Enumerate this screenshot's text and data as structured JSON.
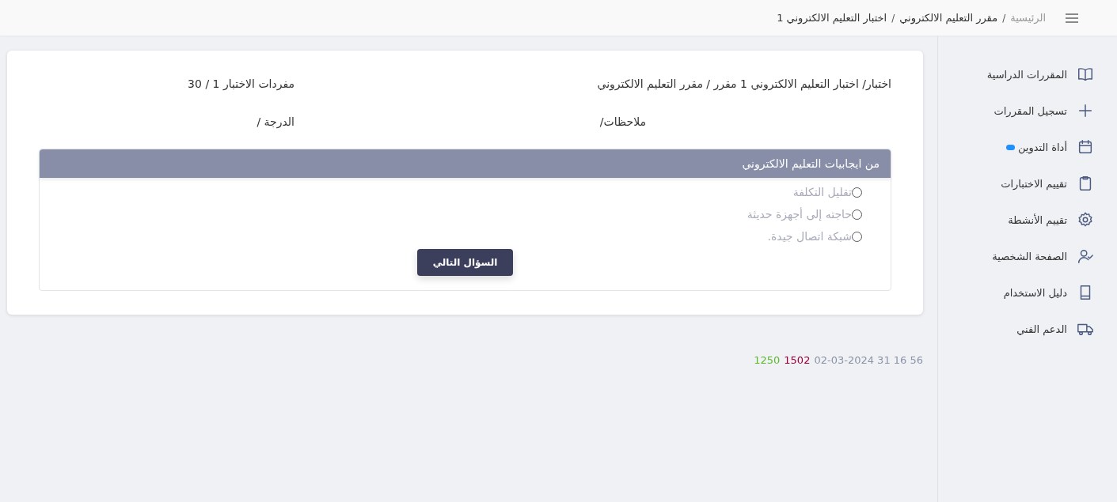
{
  "breadcrumb_separator": "/",
  "breadcrumb": [
    {
      "label": "الرئيسية",
      "current": false
    },
    {
      "label": "مقرر التعليم الالكتروني",
      "current": true
    },
    {
      "label": "اختبار التعليم الالكتروني 1",
      "current": true
    }
  ],
  "sidebar": {
    "items": [
      {
        "label": "المقررات الدراسية",
        "kind": "book",
        "badge": false
      },
      {
        "label": "تسجيل المقررات",
        "kind": "plus",
        "badge": false
      },
      {
        "label": "أداة التدوين",
        "kind": "calendar",
        "badge": true
      },
      {
        "label": "تقييم الاختبارات",
        "kind": "clipboard",
        "badge": false
      },
      {
        "label": "تقييم الأنشطة",
        "kind": "gear",
        "badge": false
      },
      {
        "label": "الصفحة الشخصية",
        "kind": "user",
        "badge": false
      },
      {
        "label": "دليل الاستخدام",
        "kind": "manual",
        "badge": false
      },
      {
        "label": "الدعم الفني",
        "kind": "truck",
        "badge": false
      }
    ]
  },
  "exam": {
    "title": "اختبار/ اختبار التعليم الالكتروني 1 مقرر / مقرر التعليم الالكتروني",
    "items_count": "مفردات الاختبار 1 / 30",
    "notes": "ملاحظات/",
    "grade": "الدرجة /"
  },
  "question": {
    "text": "من ايجابيات التعليم الالكتروني",
    "options": [
      {
        "label": "تقليل التكلفة",
        "selected": false
      },
      {
        "label": "حاجته إلى أجهزة حديثة",
        "selected": false
      },
      {
        "label": "شبكة اتصال جيدة.",
        "selected": false
      }
    ],
    "next_button": "السؤال التالي"
  },
  "footer": [
    {
      "text": "02-03-2024 31 16 56",
      "color": "#8a93a8"
    },
    {
      "text": "1502",
      "color": "#990033"
    },
    {
      "text": "1250",
      "color": "#5cb82e"
    }
  ]
}
